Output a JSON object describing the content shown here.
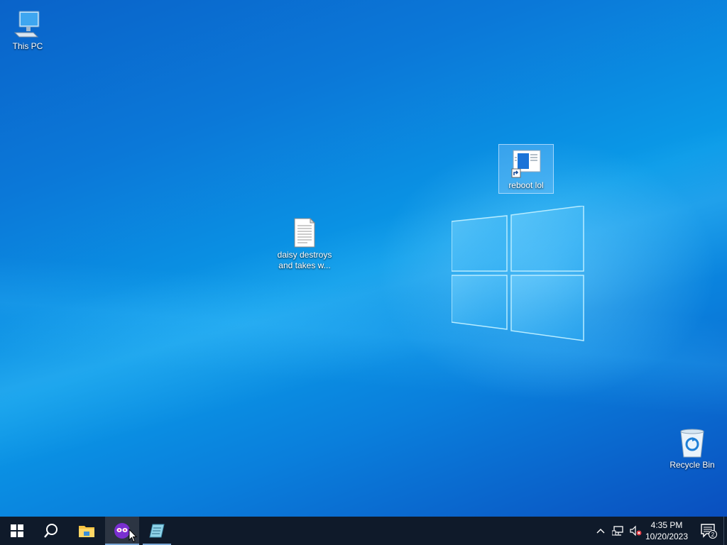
{
  "desktop": {
    "icons": {
      "this_pc": {
        "label": "This PC",
        "icon": "computer-icon"
      },
      "reboot_lol": {
        "label": "reboot lol",
        "icon": "shortcut-app-icon",
        "selected": true
      },
      "daisy_file": {
        "label": "daisy destroys and takes w...",
        "icon": "text-document-icon"
      },
      "recycle_bin": {
        "label": "Recycle Bin",
        "icon": "recycle-bin-icon"
      }
    },
    "wallpaper": {
      "accent": "#0a78d8",
      "logo": "windows-logo"
    }
  },
  "taskbar": {
    "background": "#0f1a2a",
    "start": {
      "icon": "windows-start-icon"
    },
    "search": {
      "icon": "search-icon"
    },
    "pinned": [
      {
        "name": "File Explorer",
        "icon": "folder-icon"
      },
      {
        "name": "app-purple",
        "icon": "purple-mask-icon",
        "active": true
      },
      {
        "name": "app-notepad",
        "icon": "notepad-icon",
        "running": true
      }
    ],
    "tray": {
      "chevron_icon": "chevron-up-icon",
      "network_icon": "network-icon",
      "volume_icon": "volume-muted-icon"
    },
    "clock": {
      "time": "4:35 PM",
      "date": "10/20/2023"
    },
    "notifications": {
      "icon": "action-center-icon",
      "count": "2"
    }
  }
}
